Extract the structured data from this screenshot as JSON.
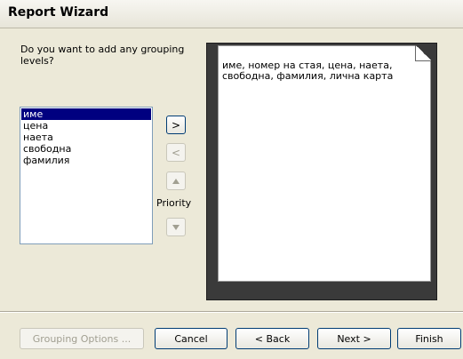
{
  "window": {
    "title": "Report Wizard"
  },
  "prompt": "Do you want to add any grouping levels?",
  "fields": [
    "име",
    "цена",
    "наета",
    "свободна",
    "фамилия"
  ],
  "selected_field": "име",
  "arrows": {
    "add": ">",
    "remove": "<"
  },
  "priority_label": "Priority",
  "preview_text": "име, номер на стая, цена, наета, свободна, фамилия, лична карта",
  "buttons": {
    "grouping_options": "Grouping Options ...",
    "cancel": "Cancel",
    "back": "< Back",
    "next": "Next >",
    "finish": "Finish"
  }
}
